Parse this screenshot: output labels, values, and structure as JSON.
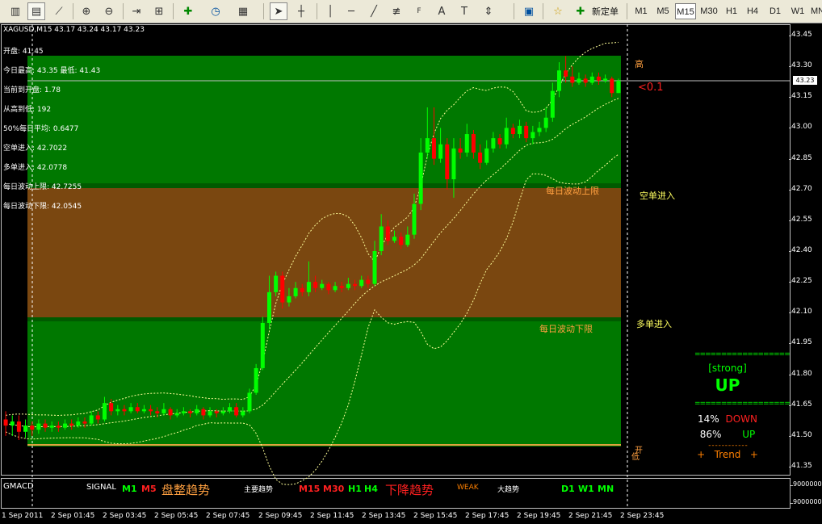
{
  "toolbar": {
    "new_order_label": "新定单",
    "timeframes": [
      "M1",
      "M5",
      "M15",
      "M30",
      "H1",
      "H4",
      "D1",
      "W1",
      "MN"
    ],
    "active_timeframe": "M15"
  },
  "chart": {
    "symbol_line": "XAGUSD,M15  43.17 43.24 43.17 43.23",
    "current_price": "43.23",
    "info": [
      "开盘: 41.45",
      "今日最高: 43.35  最低: 41.43",
      "当前到开盘: 1.78",
      "从高到低: 192",
      "50%每日平均: 0.6477",
      "空单进入: 42.7022",
      "多单进入: 42.0778",
      "每日波动上限: 42.7255",
      "每日波动下限: 42.0545"
    ],
    "price_axis": [
      "43.45",
      "43.30",
      "43.15",
      "43.00",
      "42.85",
      "42.70",
      "42.55",
      "42.40",
      "42.25",
      "42.10",
      "41.95",
      "41.80",
      "41.65",
      "41.50",
      "41.35"
    ],
    "zone_labels": {
      "high": "高",
      "ratio": "<0.1",
      "upper_limit": "每日波动上限",
      "short_entry": "空单进入",
      "lower_limit": "每日波动下限",
      "long_entry": "多单进入",
      "open_low": "开",
      "low": "低"
    },
    "signal_panel": {
      "strength": "[strong]",
      "direction": "UP",
      "down_pct": "14%",
      "down_label": "DOWN",
      "up_pct": "86%",
      "up_label": "UP",
      "trend_label": "+   Trend   +"
    },
    "time_axis": [
      "1 Sep 2011",
      "2 Sep 01:45",
      "2 Sep 03:45",
      "2 Sep 05:45",
      "2 Sep 07:45",
      "2 Sep 09:45",
      "2 Sep 11:45",
      "2 Sep 13:45",
      "2 Sep 15:45",
      "2 Sep 17:45",
      "2 Sep 19:45",
      "2 Sep 21:45",
      "2 Sep 23:45"
    ]
  },
  "indicator": {
    "name": "GMACD",
    "signal_label": "SIGNAL",
    "m1": "M1",
    "m5": "M5",
    "consolidation": "盘整趋势",
    "main_trend": "主要趋势",
    "m15": "M15",
    "m30": "M30",
    "h1": "H1",
    "h4": "H4",
    "down_trend": "下降趋势",
    "weak": "WEAK",
    "big_trend": "大趋势",
    "d1": "D1",
    "w1": "W1",
    "mn": "MN",
    "axis_top": "9000000",
    "axis_bottom": "9000000"
  },
  "candles": [
    [
      41.58,
      41.55,
      41.62,
      41.5
    ],
    [
      41.55,
      41.57,
      41.6,
      41.5
    ],
    [
      41.57,
      41.52,
      41.6,
      41.48
    ],
    [
      41.52,
      41.55,
      41.58,
      41.49
    ],
    [
      41.55,
      41.53,
      41.57,
      41.5
    ],
    [
      41.53,
      41.56,
      41.58,
      41.51
    ],
    [
      41.56,
      41.54,
      41.58,
      41.52
    ],
    [
      41.54,
      41.55,
      41.57,
      41.52
    ],
    [
      41.55,
      41.54,
      41.57,
      41.52
    ],
    [
      41.54,
      41.56,
      41.58,
      41.53
    ],
    [
      41.56,
      41.55,
      41.58,
      41.53
    ],
    [
      41.55,
      41.57,
      41.59,
      41.54
    ],
    [
      41.57,
      41.56,
      41.59,
      41.54
    ],
    [
      41.56,
      41.6,
      41.62,
      41.55
    ],
    [
      41.6,
      41.58,
      41.62,
      41.56
    ],
    [
      41.58,
      41.66,
      41.69,
      41.57
    ],
    [
      41.66,
      41.62,
      41.68,
      41.6
    ],
    [
      41.62,
      41.63,
      41.65,
      41.6
    ],
    [
      41.63,
      41.62,
      41.65,
      41.6
    ],
    [
      41.62,
      41.64,
      41.66,
      41.61
    ],
    [
      41.64,
      41.62,
      41.66,
      41.61
    ],
    [
      41.62,
      41.63,
      41.65,
      41.61
    ],
    [
      41.63,
      41.62,
      41.65,
      41.6
    ],
    [
      41.62,
      41.61,
      41.64,
      41.59
    ],
    [
      41.61,
      41.63,
      41.66,
      41.6
    ],
    [
      41.63,
      41.6,
      41.64,
      41.58
    ],
    [
      41.6,
      41.61,
      41.63,
      41.59
    ],
    [
      41.61,
      41.62,
      41.64,
      41.6
    ],
    [
      41.62,
      41.61,
      41.63,
      41.59
    ],
    [
      41.61,
      41.63,
      41.65,
      41.6
    ],
    [
      41.63,
      41.6,
      41.64,
      41.58
    ],
    [
      41.6,
      41.62,
      41.64,
      41.59
    ],
    [
      41.62,
      41.61,
      41.63,
      41.59
    ],
    [
      41.61,
      41.62,
      41.64,
      41.6
    ],
    [
      41.62,
      41.64,
      41.66,
      41.61
    ],
    [
      41.64,
      41.6,
      41.66,
      41.59
    ],
    [
      41.6,
      41.62,
      41.64,
      41.59
    ],
    [
      41.62,
      41.71,
      41.73,
      41.61
    ],
    [
      41.71,
      41.83,
      41.85,
      41.7
    ],
    [
      41.83,
      42.05,
      42.08,
      41.82
    ],
    [
      42.05,
      42.2,
      42.28,
      42.02
    ],
    [
      42.2,
      42.28,
      42.3,
      42.18
    ],
    [
      42.28,
      42.15,
      42.3,
      42.12
    ],
    [
      42.15,
      42.18,
      42.22,
      42.13
    ],
    [
      42.18,
      42.22,
      42.25,
      42.17
    ],
    [
      42.22,
      42.2,
      42.24,
      42.18
    ],
    [
      42.2,
      42.25,
      42.35,
      42.18
    ],
    [
      42.25,
      42.22,
      42.28,
      42.2
    ],
    [
      42.22,
      42.24,
      42.26,
      42.21
    ],
    [
      42.24,
      42.21,
      42.25,
      42.19
    ],
    [
      42.21,
      42.23,
      42.25,
      42.2
    ],
    [
      42.23,
      42.22,
      42.25,
      42.2
    ],
    [
      42.22,
      42.24,
      42.27,
      42.21
    ],
    [
      42.24,
      42.23,
      42.26,
      42.21
    ],
    [
      42.23,
      42.26,
      42.28,
      42.22
    ],
    [
      42.26,
      42.24,
      42.28,
      42.22
    ],
    [
      42.24,
      42.4,
      42.45,
      42.23
    ],
    [
      42.4,
      42.52,
      42.58,
      42.38
    ],
    [
      42.52,
      42.45,
      42.55,
      42.43
    ],
    [
      42.45,
      42.47,
      42.5,
      42.44
    ],
    [
      42.47,
      42.43,
      42.49,
      42.41
    ],
    [
      42.43,
      42.48,
      42.52,
      42.42
    ],
    [
      42.48,
      42.63,
      42.68,
      42.46
    ],
    [
      42.63,
      42.88,
      42.95,
      42.6
    ],
    [
      42.88,
      42.95,
      43.1,
      42.85
    ],
    [
      42.95,
      42.85,
      43.1,
      42.82
    ],
    [
      42.85,
      42.92,
      43.0,
      42.83
    ],
    [
      42.92,
      42.75,
      42.95,
      42.7
    ],
    [
      42.75,
      42.9,
      42.95,
      42.66
    ],
    [
      42.9,
      42.88,
      42.95,
      42.85
    ],
    [
      42.88,
      42.97,
      43.02,
      42.86
    ],
    [
      42.97,
      42.88,
      42.99,
      42.85
    ],
    [
      42.88,
      42.83,
      42.92,
      42.8
    ],
    [
      42.83,
      42.9,
      42.94,
      42.82
    ],
    [
      42.9,
      42.95,
      42.98,
      42.88
    ],
    [
      42.95,
      42.92,
      42.97,
      42.9
    ],
    [
      42.92,
      43.0,
      43.05,
      42.9
    ],
    [
      43.0,
      42.97,
      43.02,
      42.95
    ],
    [
      42.97,
      43.01,
      43.04,
      42.95
    ],
    [
      43.01,
      42.95,
      43.03,
      42.93
    ],
    [
      42.95,
      42.98,
      43.01,
      42.92
    ],
    [
      42.98,
      43.0,
      43.03,
      42.96
    ],
    [
      43.0,
      43.05,
      43.1,
      42.98
    ],
    [
      43.05,
      43.18,
      43.22,
      43.03
    ],
    [
      43.18,
      43.28,
      43.32,
      43.15
    ],
    [
      43.28,
      43.25,
      43.35,
      43.22
    ],
    [
      43.25,
      43.22,
      43.3,
      43.2
    ],
    [
      43.22,
      43.24,
      43.27,
      43.21
    ],
    [
      43.24,
      43.22,
      43.26,
      43.2
    ],
    [
      43.22,
      43.25,
      43.27,
      43.21
    ],
    [
      43.25,
      43.23,
      43.27,
      43.21
    ],
    [
      43.23,
      43.24,
      43.26,
      43.22
    ],
    [
      43.24,
      43.17,
      43.25,
      43.15
    ],
    [
      43.17,
      43.23,
      43.24,
      43.17
    ]
  ],
  "colors": {
    "green_zone": "#007800",
    "brown_zone": "#7a4710",
    "bull": "#00ff00",
    "bear": "#ff0000",
    "band": "#ffff99",
    "orange_text": "#ffa040"
  }
}
